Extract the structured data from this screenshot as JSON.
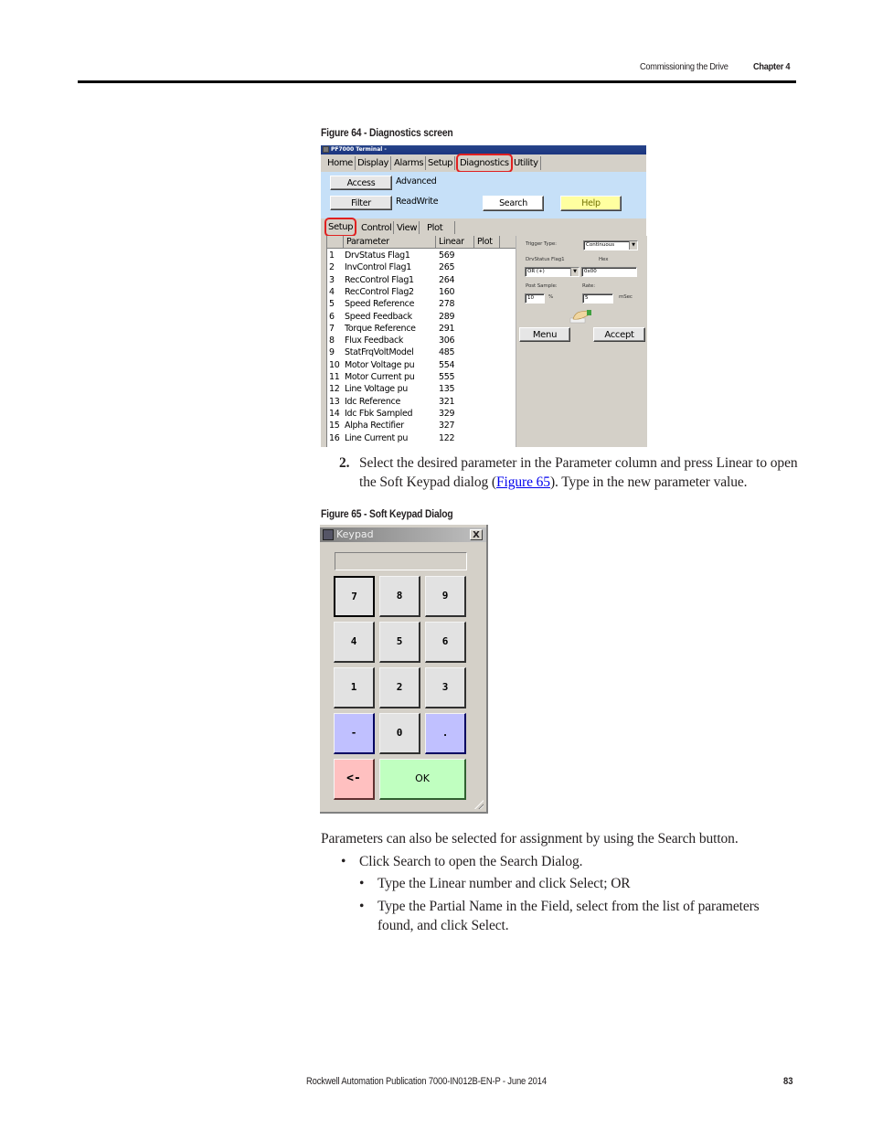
{
  "header": {
    "section": "Commissioning the Drive",
    "chapter": "Chapter 4"
  },
  "figure64": {
    "caption": "Figure 64 - Diagnostics screen",
    "window_title": "PF7000 Terminal -",
    "menu_tabs": [
      "Home",
      "Display",
      "Alarms",
      "Setup",
      "Diagnostics",
      "Utility"
    ],
    "active_menu_tab": "Diagnostics",
    "access_button": "Access",
    "access_value": "Advanced",
    "filter_button": "Filter",
    "filter_value": "ReadWrite",
    "search_button": "Search",
    "help_button": "Help",
    "sub_tabs": [
      "Setup",
      "Control",
      "View",
      "Plot"
    ],
    "active_sub_tab": "Setup",
    "columns": [
      "Parameter",
      "Linear",
      "Plot"
    ],
    "rows": [
      {
        "n": "1",
        "param": "DrvStatus Flag1",
        "linear": "569"
      },
      {
        "n": "2",
        "param": "InvControl Flag1",
        "linear": "265"
      },
      {
        "n": "3",
        "param": "RecControl Flag1",
        "linear": "264"
      },
      {
        "n": "4",
        "param": "RecControl Flag2",
        "linear": "160"
      },
      {
        "n": "5",
        "param": "Speed Reference",
        "linear": "278"
      },
      {
        "n": "6",
        "param": "Speed Feedback",
        "linear": "289"
      },
      {
        "n": "7",
        "param": "Torque Reference",
        "linear": "291"
      },
      {
        "n": "8",
        "param": "Flux Feedback",
        "linear": "306"
      },
      {
        "n": "9",
        "param": "StatFrqVoltModel",
        "linear": "485"
      },
      {
        "n": "10",
        "param": "Motor Voltage pu",
        "linear": "554"
      },
      {
        "n": "11",
        "param": "Motor Current pu",
        "linear": "555"
      },
      {
        "n": "12",
        "param": "Line Voltage pu",
        "linear": "135"
      },
      {
        "n": "13",
        "param": "Idc Reference",
        "linear": "321"
      },
      {
        "n": "14",
        "param": "Idc Fbk Sampled",
        "linear": "329"
      },
      {
        "n": "15",
        "param": "Alpha Rectifier",
        "linear": "327"
      },
      {
        "n": "16",
        "param": "Line Current pu",
        "linear": "122"
      }
    ],
    "trigger_panel": {
      "trigger_type_label": "Trigger Type:",
      "trigger_type_value": "Continuous",
      "flag_label": "DrvStatus Flag1",
      "hex_label": "Hex",
      "condition_value": "OR (+)",
      "hex_value": "0x00",
      "post_sample_label": "Post Sample:",
      "post_sample_value": "10",
      "post_sample_unit": "%",
      "rate_label": "Rate:",
      "rate_value": "5",
      "rate_unit": "mSec",
      "menu_button": "Menu",
      "accept_button": "Accept"
    }
  },
  "step2": {
    "number": "2.",
    "text_before": "Select the desired parameter in the Parameter column and press Linear to open the Soft Keypad dialog (",
    "link": "Figure 65",
    "text_after": "). Type in the new parameter value."
  },
  "figure65": {
    "caption": "Figure 65 - Soft Keypad Dialog",
    "title": "Keypad",
    "close": "X",
    "display_value": "",
    "keys": [
      "7",
      "8",
      "9",
      "4",
      "5",
      "6",
      "1",
      "2",
      "3",
      "-",
      "0",
      ".",
      "<-",
      "OK"
    ]
  },
  "body": {
    "paragraph": "Parameters can also be selected for assignment by using the Search button.",
    "bullet1": "Click Search to open the Search Dialog.",
    "sub_bullets": [
      "Type the Linear number and click Select; OR",
      "Type the Partial Name in the Field, select from the list of parameters",
      "found, and click Select."
    ],
    "bullet_char": "•"
  },
  "footer": {
    "publication": "Rockwell Automation Publication 7000-IN012B-EN-P - June 2014",
    "page": "83"
  },
  "colors": {
    "blue_panel": "#c6e0f8",
    "help_button": "#ffffa0",
    "highlight_circle": "#e02020",
    "key_blue": "#c0c0ff",
    "key_red": "#ffc0c0",
    "key_green": "#c0ffc0"
  }
}
